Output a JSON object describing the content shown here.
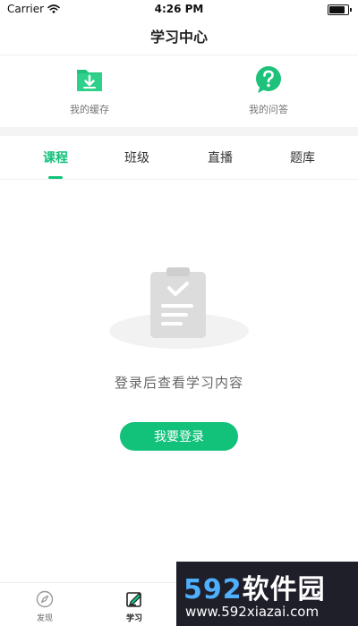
{
  "status_bar": {
    "carrier": "Carrier",
    "time": "4:26 PM"
  },
  "nav": {
    "title": "学习中心"
  },
  "quick_actions": [
    {
      "label": "我的缓存",
      "icon": "download-folder-icon"
    },
    {
      "label": "我的问答",
      "icon": "question-bubble-icon"
    }
  ],
  "tabs": [
    {
      "label": "课程",
      "active": true
    },
    {
      "label": "班级",
      "active": false
    },
    {
      "label": "直播",
      "active": false
    },
    {
      "label": "题库",
      "active": false
    }
  ],
  "empty_state": {
    "message": "登录后查看学习内容",
    "button_label": "我要登录",
    "icon": "clipboard-check-icon"
  },
  "bottom_nav": [
    {
      "label": "发现",
      "icon": "compass-icon",
      "active": false
    },
    {
      "label": "学习",
      "icon": "edit-note-icon",
      "active": true
    }
  ],
  "watermark": {
    "brand_num": "592",
    "brand_cn": "软件园",
    "url": "www.592xiazai.com"
  },
  "colors": {
    "accent": "#12c17a",
    "text": "#333333",
    "muted": "#777777",
    "band": "#f4f4f4"
  }
}
